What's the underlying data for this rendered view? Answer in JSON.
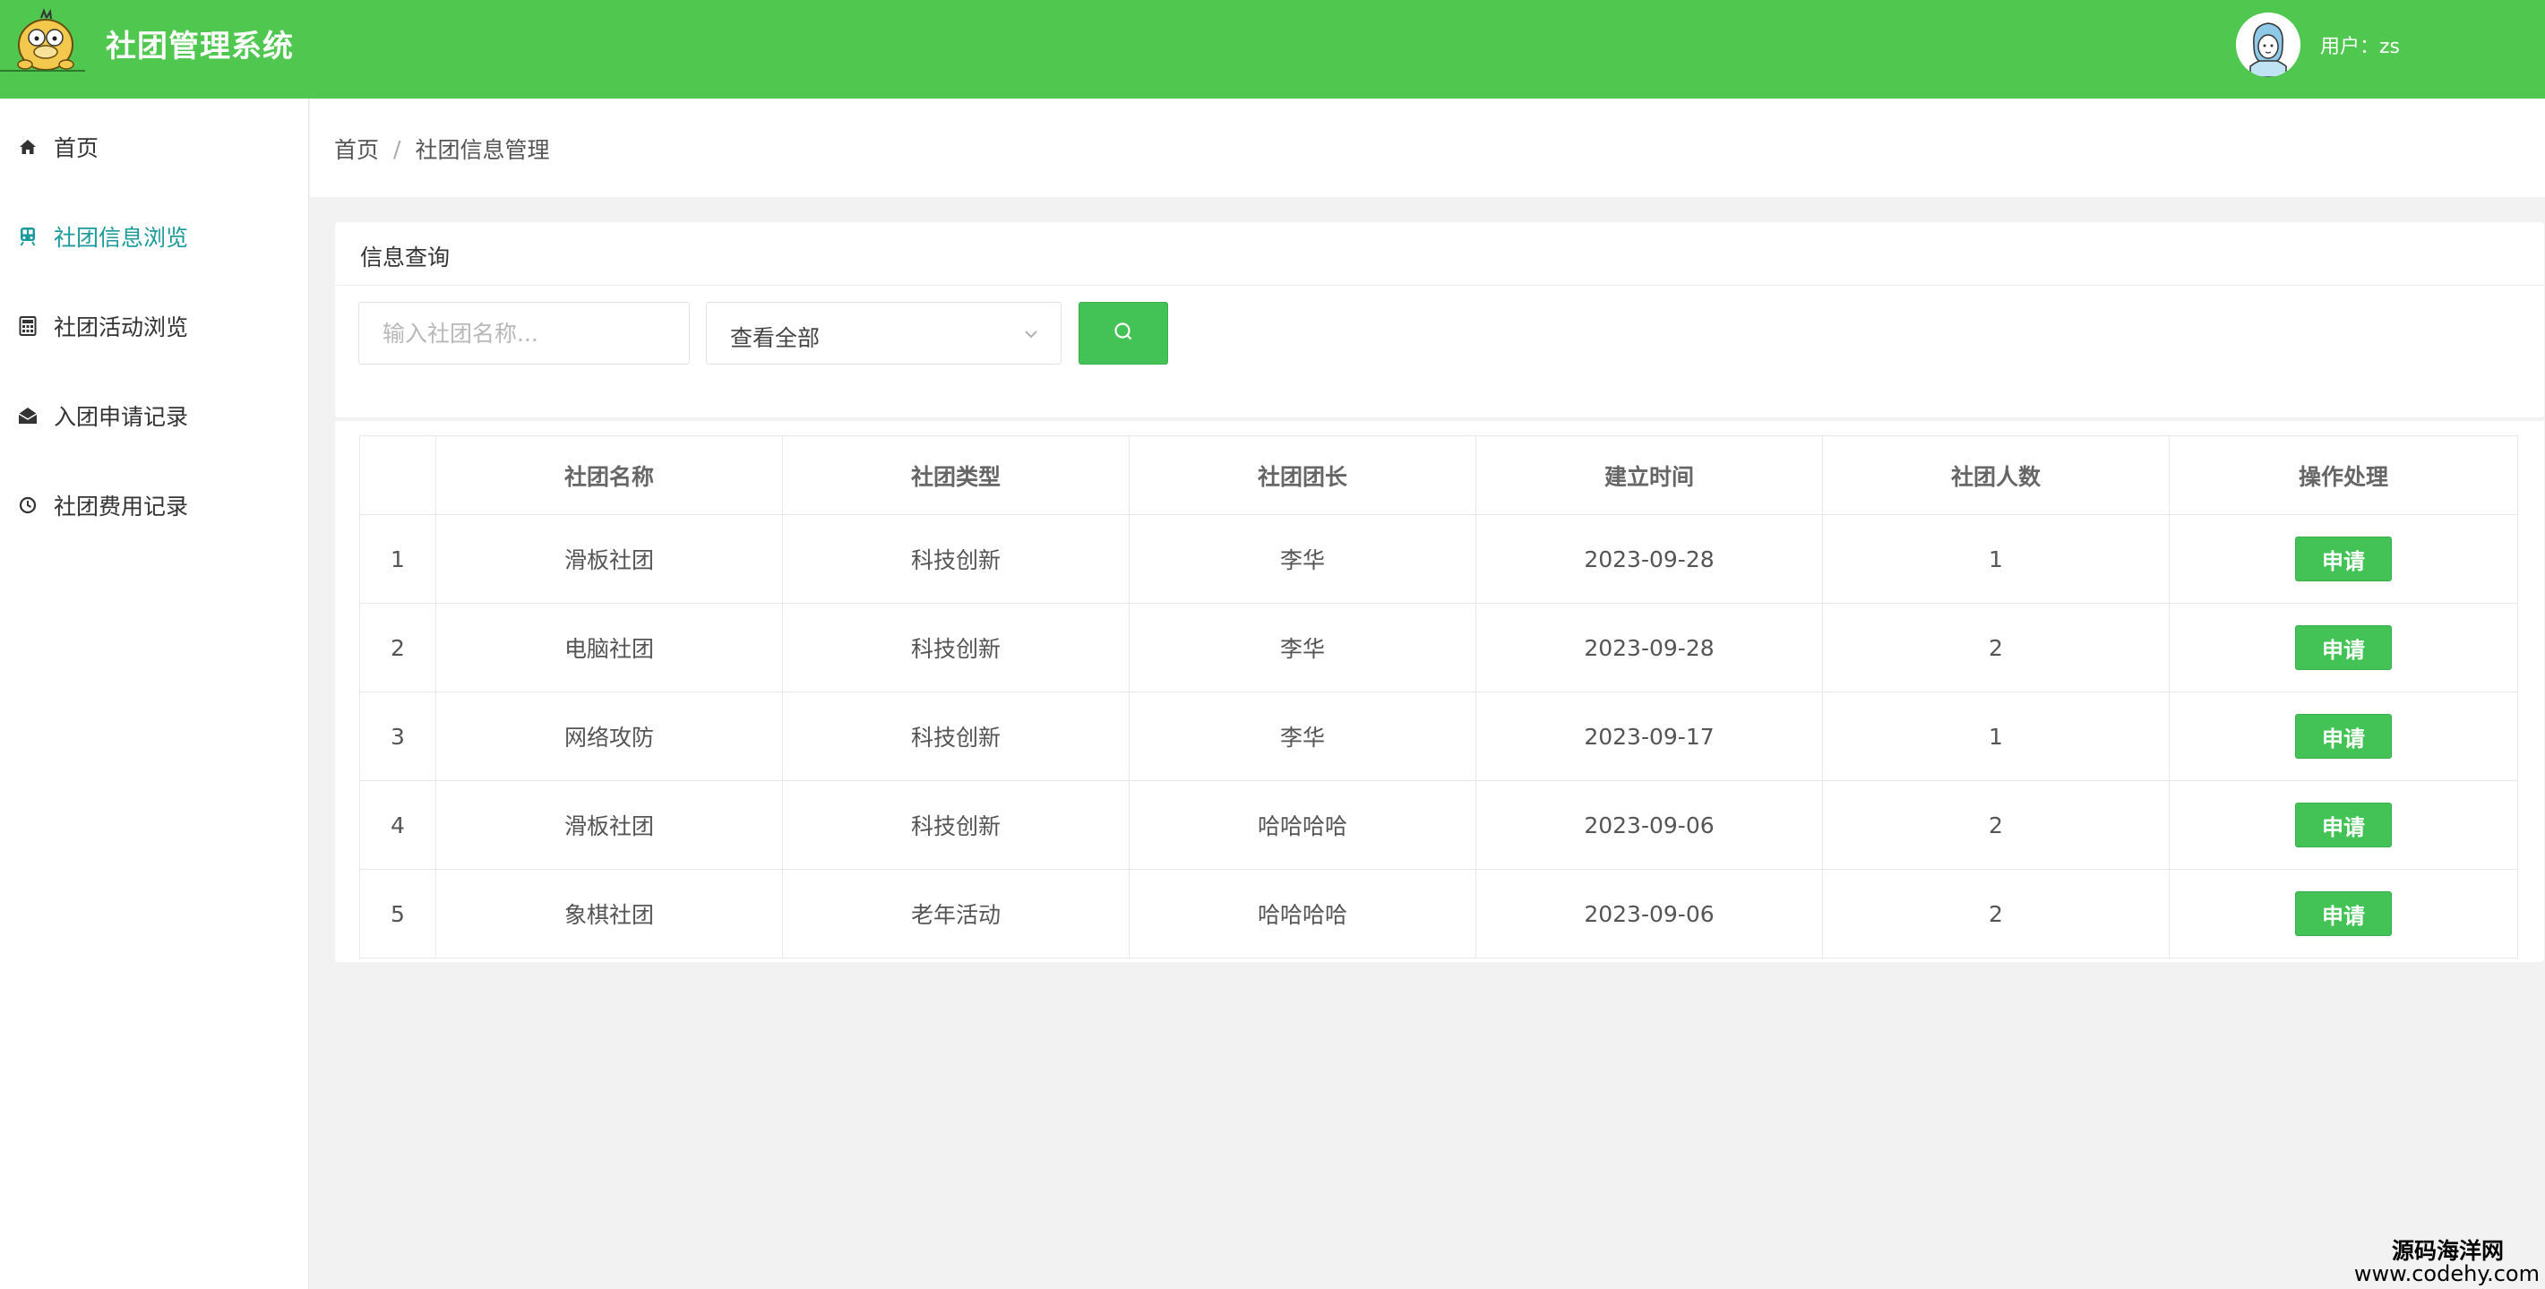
{
  "header": {
    "title": "社团管理系统",
    "user_label": "用户：zs"
  },
  "sidebar": {
    "items": [
      {
        "label": "首页",
        "icon": "home-icon",
        "active": false
      },
      {
        "label": "社团信息浏览",
        "icon": "train-icon",
        "active": true
      },
      {
        "label": "社团活动浏览",
        "icon": "calculator-icon",
        "active": false
      },
      {
        "label": "入团申请记录",
        "icon": "envelope-open-icon",
        "active": false
      },
      {
        "label": "社团费用记录",
        "icon": "clock-icon",
        "active": false
      }
    ]
  },
  "breadcrumb": {
    "home": "首页",
    "separator": "/",
    "current": "社团信息管理"
  },
  "query": {
    "title": "信息查询",
    "search_placeholder": "输入社团名称...",
    "search_value": "",
    "select_value": "查看全部"
  },
  "table": {
    "headers": [
      "",
      "社团名称",
      "社团类型",
      "社团团长",
      "建立时间",
      "社团人数",
      "操作处理"
    ],
    "rows": [
      {
        "index": "1",
        "name": "滑板社团",
        "type": "科技创新",
        "leader": "李华",
        "date": "2023-09-28",
        "count": "1",
        "action": "申请"
      },
      {
        "index": "2",
        "name": "电脑社团",
        "type": "科技创新",
        "leader": "李华",
        "date": "2023-09-28",
        "count": "2",
        "action": "申请"
      },
      {
        "index": "3",
        "name": "网络攻防",
        "type": "科技创新",
        "leader": "李华",
        "date": "2023-09-17",
        "count": "1",
        "action": "申请"
      },
      {
        "index": "4",
        "name": "滑板社团",
        "type": "科技创新",
        "leader": "哈哈哈哈",
        "date": "2023-09-06",
        "count": "2",
        "action": "申请"
      },
      {
        "index": "5",
        "name": "象棋社团",
        "type": "老年活动",
        "leader": "哈哈哈哈",
        "date": "2023-09-06",
        "count": "2",
        "action": "申请"
      }
    ]
  },
  "watermark": {
    "line1": "源码海洋网",
    "line2": "www.codehy.com"
  },
  "colors": {
    "header_bg": "#50c850",
    "button_green": "#43c256",
    "active_nav": "#1a9a9a",
    "page_bg": "#f2f2f2"
  }
}
